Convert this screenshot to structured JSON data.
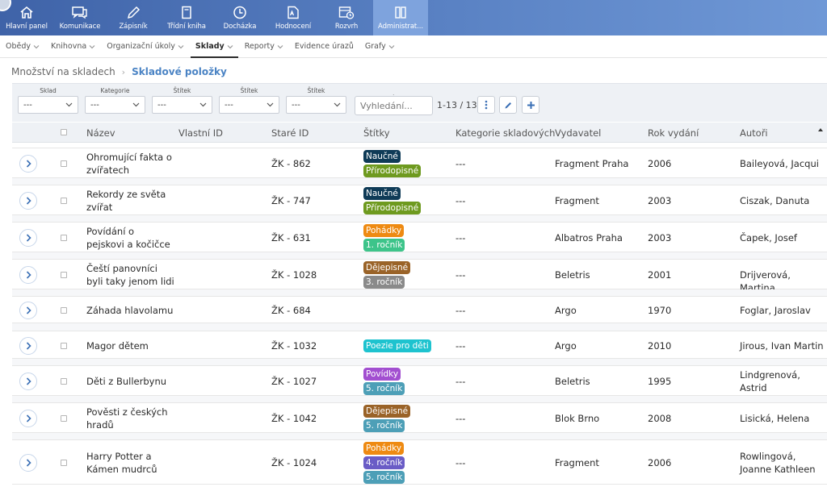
{
  "topnav": {
    "items": [
      {
        "label": "Hlavní panel",
        "icon": "home-icon"
      },
      {
        "label": "Komunikace",
        "icon": "chat-icon"
      },
      {
        "label": "Zápisník",
        "icon": "pencil-icon"
      },
      {
        "label": "Třídní kniha",
        "icon": "book-icon"
      },
      {
        "label": "Docházka",
        "icon": "clock-icon"
      },
      {
        "label": "Hodnocení",
        "icon": "grade-icon"
      },
      {
        "label": "Rozvrh",
        "icon": "schedule-icon"
      },
      {
        "label": "Administrat...",
        "icon": "admin-icon"
      }
    ],
    "active_index": 7
  },
  "subnav": {
    "items": [
      "Obědy",
      "Knihovna",
      "Organizační úkoly",
      "Sklady",
      "Reporty",
      "Evidence úrazů",
      "Grafy"
    ],
    "active_index": 3
  },
  "breadcrumb": {
    "first": "Množství na skladech",
    "current": "Skladové položky"
  },
  "filters": {
    "groups": [
      {
        "label": "Sklad",
        "value": "---"
      },
      {
        "label": "Kategorie",
        "value": "---"
      },
      {
        "label": "Štítek",
        "value": "---"
      },
      {
        "label": "Štítek",
        "value": "---"
      },
      {
        "label": "Štítek",
        "value": "---"
      }
    ],
    "search_placeholder": "Vyhledání...",
    "paging": "1-13 / 13"
  },
  "table": {
    "headers": {
      "name": "Název",
      "own_id": "Vlastní ID",
      "old_id": "Staré ID",
      "tags": "Štítky",
      "category": "Kategorie skladových",
      "publisher": "Vydavatel",
      "year": "Rok vydání",
      "authors": "Autoři"
    },
    "rows": [
      {
        "name": "Ohromující fakta o\nzvířatech",
        "old_id": "ŽK - 862",
        "tags": [
          {
            "label": "Naučné",
            "color": "#0f3b57"
          },
          {
            "label": "Přírodopisné",
            "color": "#6e9a1f"
          }
        ],
        "category": "---",
        "publisher": "Fragment Praha",
        "year": "2006",
        "authors": "Baileyová, Jacqui"
      },
      {
        "name": "Rekordy ze světa\nzvířat",
        "old_id": "ŽK - 747",
        "tags": [
          {
            "label": "Naučné",
            "color": "#0f3b57"
          },
          {
            "label": "Přírodopisné",
            "color": "#6e9a1f"
          }
        ],
        "category": "---",
        "publisher": "Fragment",
        "year": "2003",
        "authors": "Ciszak, Danuta"
      },
      {
        "name": "Povídání o\npejskovi a kočičce",
        "old_id": "ŽK - 631",
        "tags": [
          {
            "label": "Pohádky",
            "color": "#ee8a12"
          },
          {
            "label": "1. ročník",
            "color": "#3dc48a"
          }
        ],
        "category": "---",
        "publisher": "Albatros Praha",
        "year": "2003",
        "authors": "Čapek, Josef"
      },
      {
        "name": "Čeští panovníci\nbyli taky jenom lidi",
        "old_id": "ŽK - 1028",
        "tags": [
          {
            "label": "Dějepisné",
            "color": "#9a6328"
          },
          {
            "label": "3. ročník",
            "color": "#8a8a8a"
          }
        ],
        "category": "---",
        "publisher": "Beletris",
        "year": "2001",
        "authors": "Drijverová, Martina"
      },
      {
        "name": "Záhada hlavolamu",
        "old_id": "ŽK - 684",
        "tags": [],
        "category": "---",
        "publisher": "Argo",
        "year": "1970",
        "authors": "Foglar, Jaroslav"
      },
      {
        "name": "Magor dětem",
        "old_id": "ŽK - 1032",
        "tags": [
          {
            "label": "Poezie pro děti",
            "color": "#1ec3cf"
          }
        ],
        "category": "---",
        "publisher": "Argo",
        "year": "2010",
        "authors": "Jirous, Ivan Martin"
      },
      {
        "name": "Děti z Bullerbynu",
        "old_id": "ŽK - 1027",
        "tags": [
          {
            "label": "Povídky",
            "color": "#a24fd0"
          },
          {
            "label": "5. ročník",
            "color": "#4d9fb7"
          }
        ],
        "category": "---",
        "publisher": "Beletris",
        "year": "1995",
        "authors": "Lindgrenová,\nAstrid"
      },
      {
        "name": "Pověsti z českých\nhradů",
        "old_id": "ŽK - 1042",
        "tags": [
          {
            "label": "Dějepisné",
            "color": "#9a6328"
          },
          {
            "label": "5. ročník",
            "color": "#4d9fb7"
          }
        ],
        "category": "---",
        "publisher": "Blok Brno",
        "year": "2008",
        "authors": "Lisická, Helena"
      },
      {
        "name": "Harry Potter a\nKámen mudrců",
        "old_id": "ŽK - 1024",
        "tags": [
          {
            "label": "Pohádky",
            "color": "#ee8a12"
          },
          {
            "label": "4. ročník",
            "color": "#6a5cc6"
          },
          {
            "label": "5. ročník",
            "color": "#4d9fb7"
          }
        ],
        "category": "---",
        "publisher": "Fragment",
        "year": "2006",
        "authors": "Rowlingová,\nJoanne Kathleen"
      }
    ]
  }
}
